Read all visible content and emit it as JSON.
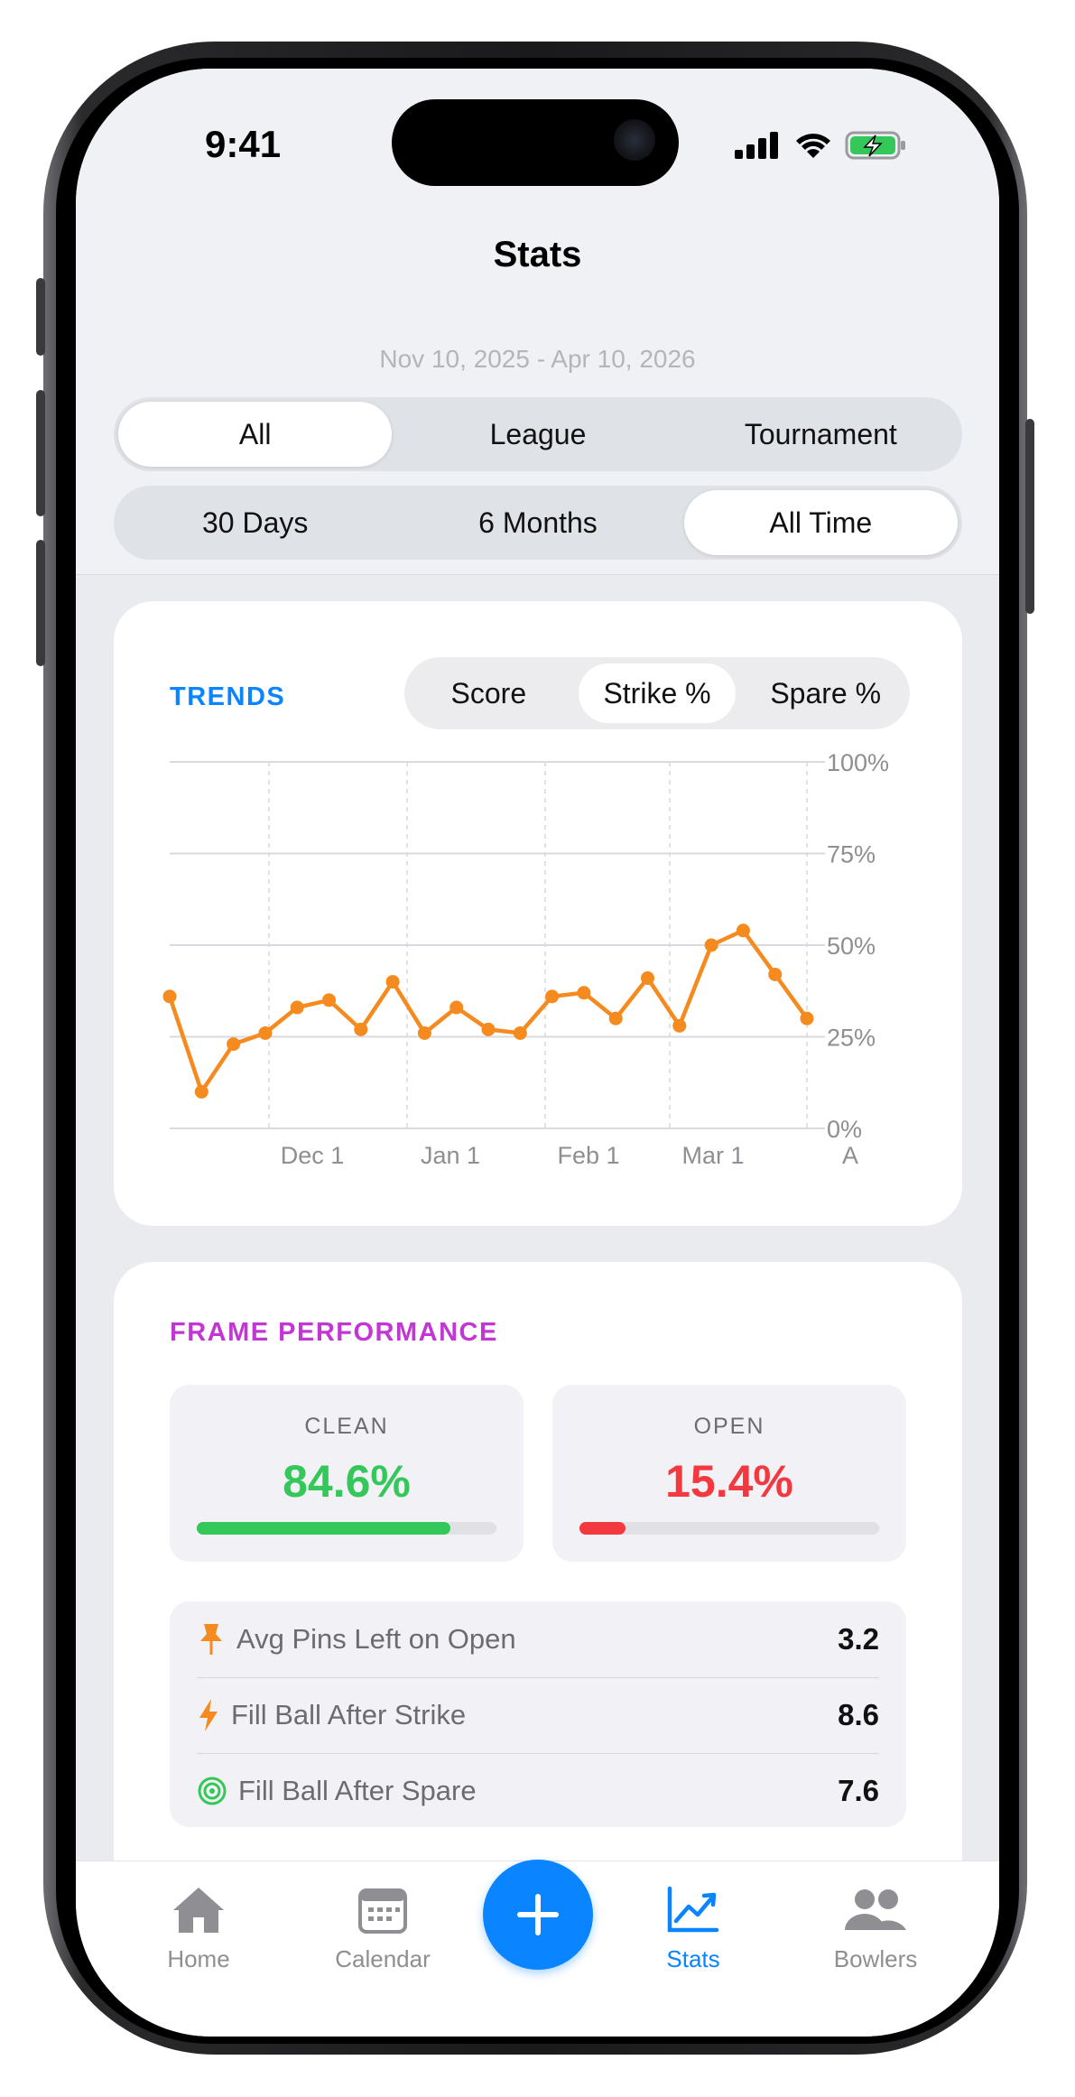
{
  "status": {
    "time": "9:41"
  },
  "header": {
    "title": "Stats",
    "date_range": "Nov 10, 2025 - Apr 10, 2026"
  },
  "type_filter": {
    "options": [
      "All",
      "League",
      "Tournament"
    ],
    "selected": "All"
  },
  "period_filter": {
    "options": [
      "30 Days",
      "6 Months",
      "All Time"
    ],
    "selected": "All Time"
  },
  "trends": {
    "title": "TRENDS",
    "title_color": "#0a84ff",
    "metrics": [
      "Score",
      "Strike %",
      "Spare %"
    ],
    "selected_metric": "Strike %"
  },
  "chart_data": {
    "type": "line",
    "title": "",
    "xlabel": "",
    "ylabel": "",
    "x_tick_labels": [
      "Dec 1",
      "Jan 1",
      "Feb 1",
      "Mar 1",
      "A"
    ],
    "y_tick_labels": [
      "100%",
      "75%",
      "50%",
      "25%",
      "0%"
    ],
    "ylim": [
      0,
      100
    ],
    "grid": true,
    "line_color": "#f58a1f",
    "series": [
      {
        "values": [
          36,
          10,
          23,
          26,
          33,
          35,
          27,
          40,
          26,
          33,
          27,
          26,
          36,
          37,
          30,
          41,
          28,
          50,
          54,
          42,
          30
        ]
      }
    ]
  },
  "frame_performance": {
    "title": "FRAME PERFORMANCE",
    "title_color": "#c236d4",
    "clean": {
      "label": "CLEAN",
      "value": "84.6%",
      "fraction": 0.846,
      "color": "#34c759"
    },
    "open": {
      "label": "OPEN",
      "value": "15.4%",
      "fraction": 0.154,
      "color": "#f2393f"
    },
    "rows": [
      {
        "icon": "pushpin-icon",
        "label": "Avg Pins Left on Open",
        "value": "3.2"
      },
      {
        "icon": "lightning-icon",
        "label": "Fill Ball After Strike",
        "value": "8.6"
      },
      {
        "icon": "target-icon",
        "label": "Fill Ball After Spare",
        "value": "7.6"
      }
    ]
  },
  "tabbar": {
    "tabs": [
      {
        "label": "Home",
        "icon": "house-icon"
      },
      {
        "label": "Calendar",
        "icon": "calendar-icon"
      },
      {
        "label": "Stats",
        "icon": "chart-icon",
        "active": true
      },
      {
        "label": "Bowlers",
        "icon": "people-icon"
      }
    ],
    "active_color": "#0a84ff",
    "inactive_color": "#8e8e93"
  }
}
